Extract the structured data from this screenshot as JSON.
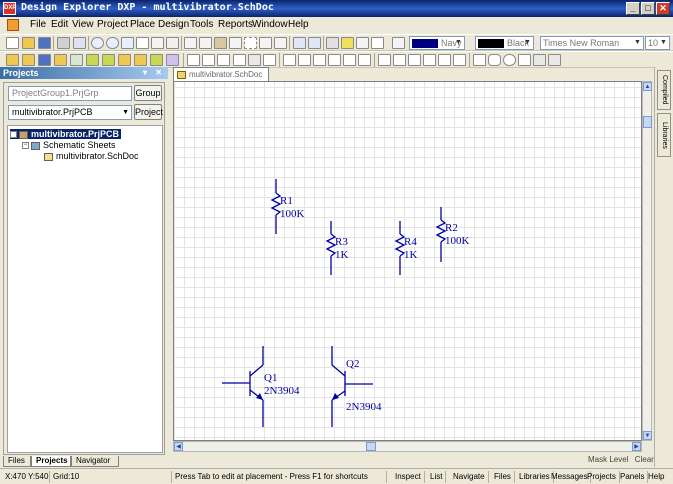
{
  "window": {
    "title": "Design Explorer DXP - multivibrator.SchDoc",
    "app_icon": "DXP"
  },
  "window_controls": {
    "minimize": "_",
    "maximize": "□",
    "close": "✕"
  },
  "menu": [
    "File",
    "Edit",
    "View",
    "Project",
    "Place",
    "Design",
    "Tools",
    "Reports",
    "Window",
    "Help"
  ],
  "toolbar": {
    "color1": {
      "label": "Navy",
      "value": "#000080"
    },
    "color2": {
      "label": "Black",
      "value": "#000000"
    },
    "font": {
      "label": "Times New Roman"
    },
    "font_size": {
      "label": "10"
    }
  },
  "projects_panel": {
    "title": "Projects",
    "workspace_field": "ProjectGroup1.PrjGrp",
    "workspace_button": "Group",
    "project_field": "multivibrator.PrjPCB",
    "project_button": "Project",
    "tree": [
      {
        "label": "multivibrator.PrjPCB",
        "level": 0,
        "selected": true
      },
      {
        "label": "Schematic Sheets",
        "level": 1,
        "selected": false
      },
      {
        "label": "multivibrator.SchDoc",
        "level": 2,
        "selected": false
      }
    ],
    "tabs": [
      "Files",
      "Projects",
      "Navigator"
    ],
    "active_tab": "Projects"
  },
  "document_tab": "multivibrator.SchDoc",
  "schematic": {
    "components": [
      {
        "designator": "R1",
        "value": "100K"
      },
      {
        "designator": "R3",
        "value": "1K"
      },
      {
        "designator": "R4",
        "value": "1K"
      },
      {
        "designator": "R2",
        "value": "100K"
      },
      {
        "designator": "Q1",
        "value": "2N3904"
      },
      {
        "designator": "Q2",
        "value": "2N3904"
      }
    ],
    "line_color": "#0000a0"
  },
  "right_panels": [
    "Compiled",
    "Libraries"
  ],
  "mini_widget": [
    "Mask Level",
    "Clear"
  ],
  "status": {
    "coords": "X:470 Y:540",
    "grid": "Grid:10",
    "message": "Press Tab to edit at placement - Press F1 for shortcuts",
    "panels_left": [
      "Inspect",
      "List",
      "Navigate"
    ],
    "panels_right": [
      "Files",
      "Libraries",
      "Messages",
      "Projects",
      "Panels",
      "Help"
    ]
  }
}
